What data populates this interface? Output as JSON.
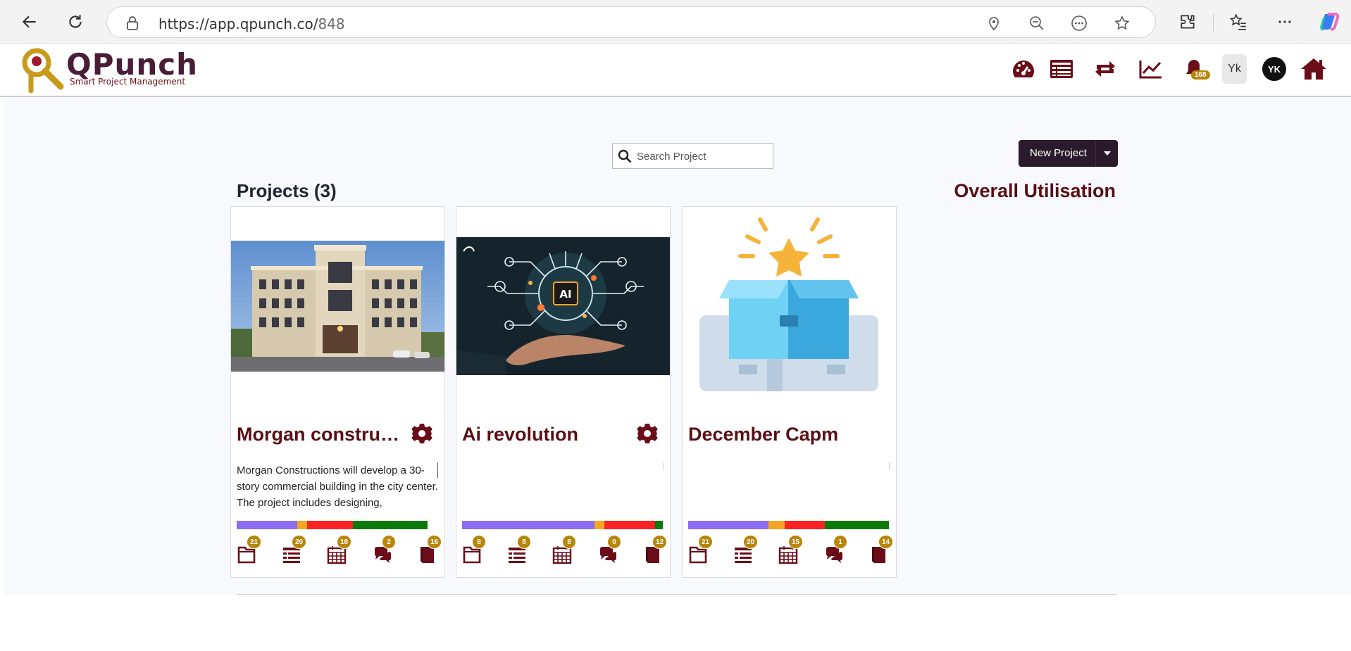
{
  "browser": {
    "url_host": "https://app.qpunch.co/",
    "url_path": "848"
  },
  "app": {
    "logo_title": "QPunch",
    "logo_subtitle": "Smart Project Management",
    "notifications_count": "168",
    "user_initials": "Yk",
    "avatar_initials": "YK"
  },
  "search": {
    "placeholder": "Search Project"
  },
  "toolbar": {
    "new_project_label": "New Project"
  },
  "projects": {
    "title": "Projects (3)",
    "utilisation_title": "Overall Utilisation",
    "items": [
      {
        "name": "Morgan construct...",
        "description": "Morgan Constructions will develop a 30-story commercial building in the city center. The project includes designing,",
        "has_settings": true,
        "image": "building-photo",
        "progress": [
          0.3,
          0.05,
          0.23,
          0.37
        ],
        "stats": [
          "21",
          "20",
          "18",
          "2",
          "16"
        ]
      },
      {
        "name": "Ai revolution",
        "description": "",
        "has_settings": true,
        "image": "ai-hand-photo",
        "progress": [
          0.66,
          0.05,
          0.25,
          0.04
        ],
        "stats": [
          "8",
          "8",
          "8",
          "0",
          "12"
        ]
      },
      {
        "name": "December Capm",
        "description": "",
        "has_settings": false,
        "image": "open-box-illustration",
        "progress": [
          0.4,
          0.08,
          0.2,
          0.32
        ],
        "stats": [
          "21",
          "20",
          "15",
          "1",
          "14"
        ]
      }
    ]
  },
  "colors": {
    "brand": "#5a0f14",
    "progress": [
      "#8b6cf2",
      "#f5a623",
      "#ff2222",
      "#0b7a0b"
    ],
    "badge": "#b8860b"
  }
}
